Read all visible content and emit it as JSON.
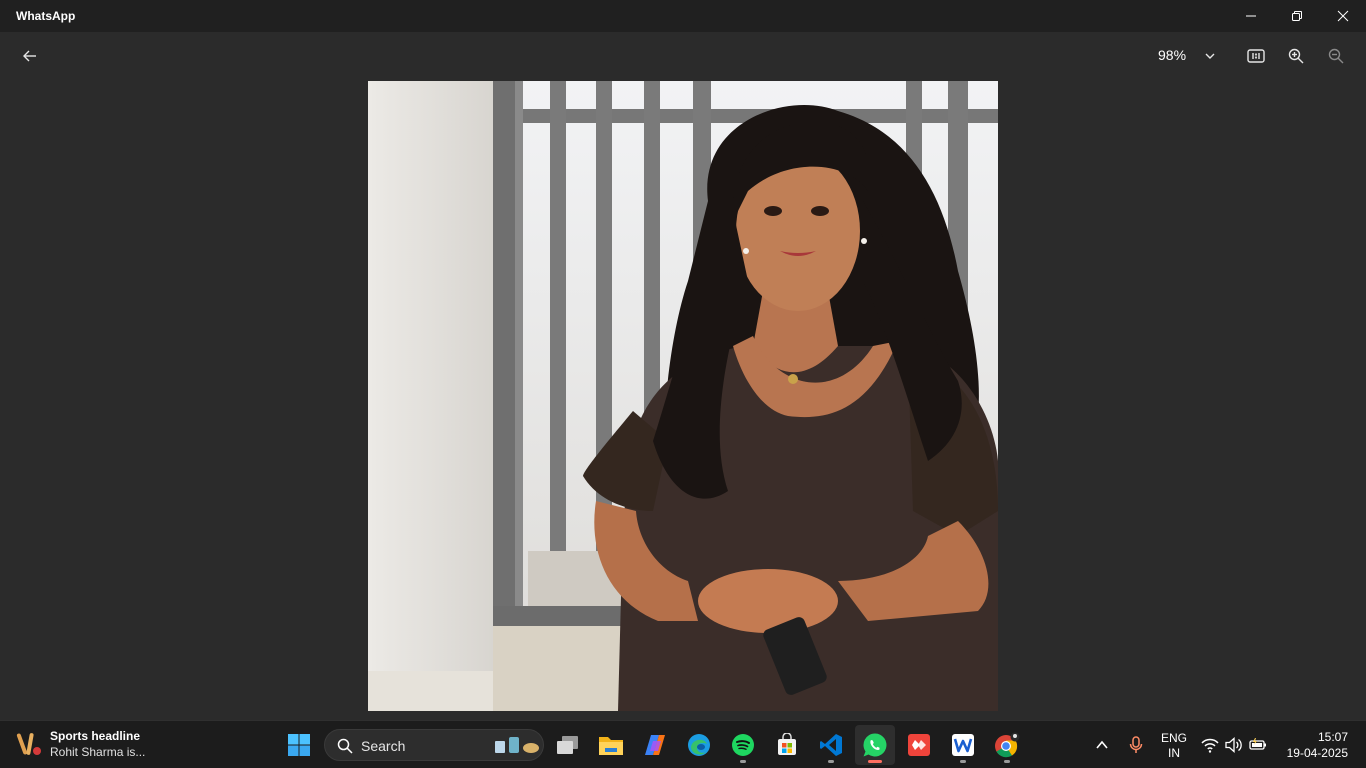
{
  "window": {
    "title": "WhatsApp"
  },
  "toolbar": {
    "zoom_level": "98%"
  },
  "viewer": {
    "image_alt": "Photo of a woman with long curly hair in a dark brown dress standing in front of a grey gate"
  },
  "taskbar": {
    "widget_title": "Sports headline",
    "widget_subtitle": "Rohit Sharma is...",
    "search_label": "Search",
    "apps": [
      "start",
      "search",
      "task-view",
      "file-explorer",
      "copilot",
      "edge",
      "spotify",
      "microsoft-store",
      "vs-code",
      "whatsapp",
      "anydesk",
      "wps-writer",
      "chrome"
    ],
    "active_app": "whatsapp",
    "language_line1": "ENG",
    "language_line2": "IN",
    "time": "15:07",
    "date": "19-04-2025"
  },
  "colors": {
    "titlebar_bg": "#202020",
    "viewer_bg": "#2b2b2b",
    "taskbar_bg": "#1c1c1c",
    "active_indicator": "#ff6f61"
  }
}
